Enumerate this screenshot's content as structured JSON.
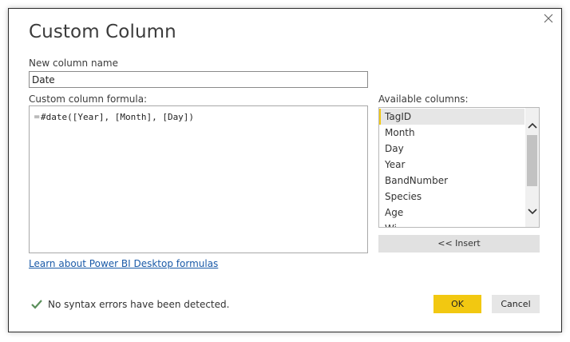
{
  "dialog": {
    "title": "Custom Column",
    "close_icon": "close-icon"
  },
  "name_field": {
    "label": "New column name",
    "value": "Date"
  },
  "formula": {
    "label": "Custom column formula:",
    "prefix": "=",
    "value": "#date([Year], [Month], [Day])"
  },
  "columns": {
    "label": "Available columns:",
    "items": [
      "TagID",
      "Month",
      "Day",
      "Year",
      "BandNumber",
      "Species",
      "Age",
      "Wi"
    ],
    "selected": "TagID",
    "scroll_up_icon": "chevron-up-icon",
    "scroll_down_icon": "chevron-down-icon"
  },
  "insert_button": "<< Insert",
  "learn_link": "Learn about Power BI Desktop formulas",
  "status": {
    "icon": "checkmark-icon",
    "text": "No syntax errors have been detected."
  },
  "buttons": {
    "ok": "OK",
    "cancel": "Cancel"
  },
  "colors": {
    "accent": "#f2c811",
    "link": "#1a5aa8",
    "check": "#5a8f5a"
  }
}
